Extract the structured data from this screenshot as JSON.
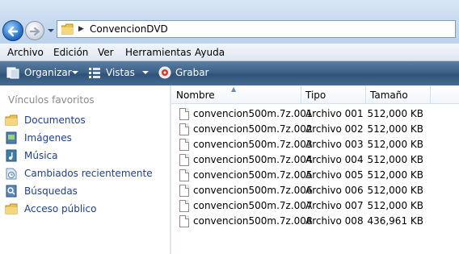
{
  "address": {
    "path": "ConvencionDVD"
  },
  "menu": [
    "Archivo",
    "Edición",
    "Ver",
    "Herramientas",
    "Ayuda"
  ],
  "toolbar": {
    "organize": "Organizar",
    "views": "Vistas",
    "burn": "Grabar"
  },
  "sidebar": {
    "heading": "Vínculos favoritos",
    "items": [
      {
        "label": "Documentos",
        "icon": "folder-icon"
      },
      {
        "label": "Imágenes",
        "icon": "pictures-icon"
      },
      {
        "label": "Música",
        "icon": "music-icon"
      },
      {
        "label": "Cambiados recientemente",
        "icon": "recent-icon"
      },
      {
        "label": "Búsquedas",
        "icon": "search-folder-icon"
      },
      {
        "label": "Acceso público",
        "icon": "folder-icon"
      }
    ]
  },
  "columns": {
    "name": "Nombre",
    "type": "Tipo",
    "size": "Tamaño"
  },
  "files": [
    {
      "name": "convencion500m.7z.001",
      "type": "Archivo 001",
      "size": "512,000 KB"
    },
    {
      "name": "convencion500m.7z.002",
      "type": "Archivo 002",
      "size": "512,000 KB"
    },
    {
      "name": "convencion500m.7z.003",
      "type": "Archivo 003",
      "size": "512,000 KB"
    },
    {
      "name": "convencion500m.7z.004",
      "type": "Archivo 004",
      "size": "512,000 KB"
    },
    {
      "name": "convencion500m.7z.005",
      "type": "Archivo 005",
      "size": "512,000 KB"
    },
    {
      "name": "convencion500m.7z.006",
      "type": "Archivo 006",
      "size": "512,000 KB"
    },
    {
      "name": "convencion500m.7z.007",
      "type": "Archivo 007",
      "size": "512,000 KB"
    },
    {
      "name": "convencion500m.7z.008",
      "type": "Archivo 008",
      "size": "436,961 KB"
    }
  ]
}
